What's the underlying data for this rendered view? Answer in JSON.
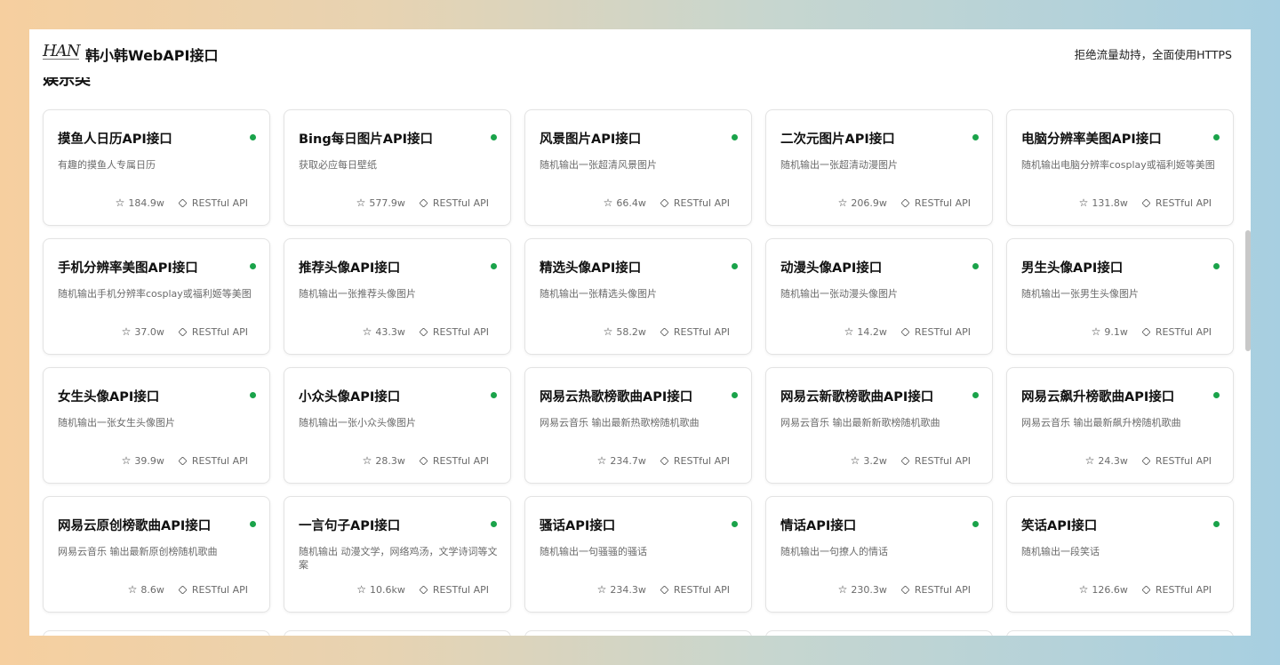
{
  "header": {
    "logo": "HAN",
    "title": "韩小韩WebAPI接口",
    "note": "拒绝流量劫持，全面使用HTTPS"
  },
  "section": {
    "heading": "娱乐类"
  },
  "cards": [
    {
      "title": "摸鱼人日历API接口",
      "desc": "有趣的摸鱼人专属日历",
      "count": "184.9w",
      "type": "RESTful API"
    },
    {
      "title": "Bing每日图片API接口",
      "desc": "获取必应每日壁纸",
      "count": "577.9w",
      "type": "RESTful API"
    },
    {
      "title": "风景图片API接口",
      "desc": "随机输出一张超清风景图片",
      "count": "66.4w",
      "type": "RESTful API"
    },
    {
      "title": "二次元图片API接口",
      "desc": "随机输出一张超清动漫图片",
      "count": "206.9w",
      "type": "RESTful API"
    },
    {
      "title": "电脑分辨率美图API接口",
      "desc": "随机输出电脑分辨率cosplay或福利姬等美图",
      "count": "131.8w",
      "type": "RESTful API"
    },
    {
      "title": "手机分辨率美图API接口",
      "desc": "随机输出手机分辨率cosplay或福利姬等美图",
      "count": "37.0w",
      "type": "RESTful API"
    },
    {
      "title": "推荐头像API接口",
      "desc": "随机输出一张推荐头像图片",
      "count": "43.3w",
      "type": "RESTful API"
    },
    {
      "title": "精选头像API接口",
      "desc": "随机输出一张精选头像图片",
      "count": "58.2w",
      "type": "RESTful API"
    },
    {
      "title": "动漫头像API接口",
      "desc": "随机输出一张动漫头像图片",
      "count": "14.2w",
      "type": "RESTful API"
    },
    {
      "title": "男生头像API接口",
      "desc": "随机输出一张男生头像图片",
      "count": "9.1w",
      "type": "RESTful API"
    },
    {
      "title": "女生头像API接口",
      "desc": "随机输出一张女生头像图片",
      "count": "39.9w",
      "type": "RESTful API"
    },
    {
      "title": "小众头像API接口",
      "desc": "随机输出一张小众头像图片",
      "count": "28.3w",
      "type": "RESTful API"
    },
    {
      "title": "网易云热歌榜歌曲API接口",
      "desc": "网易云音乐 输出最新热歌榜随机歌曲",
      "count": "234.7w",
      "type": "RESTful API"
    },
    {
      "title": "网易云新歌榜歌曲API接口",
      "desc": "网易云音乐 输出最新新歌榜随机歌曲",
      "count": "3.2w",
      "type": "RESTful API"
    },
    {
      "title": "网易云飙升榜歌曲API接口",
      "desc": "网易云音乐 输出最新飙升榜随机歌曲",
      "count": "24.3w",
      "type": "RESTful API"
    },
    {
      "title": "网易云原创榜歌曲API接口",
      "desc": "网易云音乐 输出最新原创榜随机歌曲",
      "count": "8.6w",
      "type": "RESTful API"
    },
    {
      "title": "一言句子API接口",
      "desc": "随机输出 动漫文学，网络鸡汤，文学诗词等文案",
      "count": "10.6kw",
      "type": "RESTful API"
    },
    {
      "title": "骚话API接口",
      "desc": "随机输出一句骚骚的骚话",
      "count": "234.3w",
      "type": "RESTful API"
    },
    {
      "title": "情话API接口",
      "desc": "随机输出一句撩人的情话",
      "count": "230.3w",
      "type": "RESTful API"
    },
    {
      "title": "笑话API接口",
      "desc": "随机输出一段笑话",
      "count": "126.6w",
      "type": "RESTful API"
    }
  ],
  "icons": {
    "star": "star-icon",
    "api": "api-cube-icon",
    "status": "status-dot",
    "status_color": "#1aa34a"
  }
}
